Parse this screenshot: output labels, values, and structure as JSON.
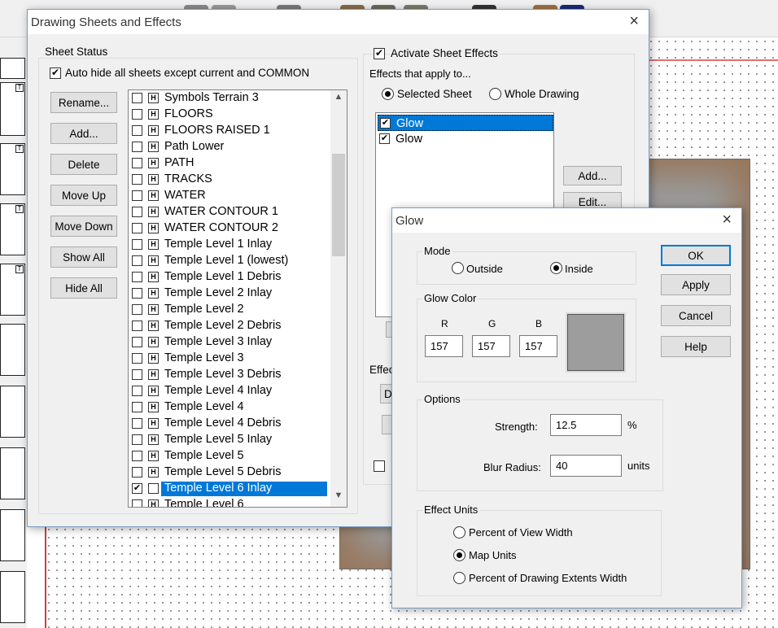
{
  "main_dialog": {
    "title": "Drawing Sheets and Effects",
    "close_glyph": "×",
    "sheet_status": {
      "label": "Sheet Status",
      "auto_hide_label": "Auto hide all sheets except current and COMMON",
      "auto_hide_checked": true,
      "buttons": [
        "Rename...",
        "Add...",
        "Delete",
        "Move Up",
        "Move Down",
        "Show All",
        "Hide All"
      ],
      "sheets": [
        {
          "name": "Symbols Terrain 3",
          "visible": false,
          "selected": false
        },
        {
          "name": "FLOORS",
          "visible": false,
          "selected": false
        },
        {
          "name": "FLOORS RAISED 1",
          "visible": false,
          "selected": false
        },
        {
          "name": "Path Lower",
          "visible": false,
          "selected": false
        },
        {
          "name": "PATH",
          "visible": false,
          "selected": false
        },
        {
          "name": "TRACKS",
          "visible": false,
          "selected": false
        },
        {
          "name": "WATER",
          "visible": false,
          "selected": false
        },
        {
          "name": "WATER CONTOUR 1",
          "visible": false,
          "selected": false
        },
        {
          "name": "WATER CONTOUR 2",
          "visible": false,
          "selected": false
        },
        {
          "name": "Temple Level 1 Inlay",
          "visible": false,
          "selected": false
        },
        {
          "name": "Temple Level 1 (lowest)",
          "visible": false,
          "selected": false
        },
        {
          "name": "Temple Level 1 Debris",
          "visible": false,
          "selected": false
        },
        {
          "name": "Temple Level 2 Inlay",
          "visible": false,
          "selected": false
        },
        {
          "name": "Temple Level 2",
          "visible": false,
          "selected": false
        },
        {
          "name": "Temple Level 2 Debris",
          "visible": false,
          "selected": false
        },
        {
          "name": "Temple Level 3 Inlay",
          "visible": false,
          "selected": false
        },
        {
          "name": "Temple Level 3",
          "visible": false,
          "selected": false
        },
        {
          "name": "Temple Level 3 Debris",
          "visible": false,
          "selected": false
        },
        {
          "name": "Temple Level 4 Inlay",
          "visible": false,
          "selected": false
        },
        {
          "name": "Temple Level 4",
          "visible": false,
          "selected": false
        },
        {
          "name": "Temple Level 4 Debris",
          "visible": false,
          "selected": false
        },
        {
          "name": "Temple Level 5 Inlay",
          "visible": false,
          "selected": false
        },
        {
          "name": "Temple Level 5",
          "visible": false,
          "selected": false
        },
        {
          "name": "Temple Level 5 Debris",
          "visible": false,
          "selected": false
        },
        {
          "name": "Temple Level 6 Inlay",
          "visible": true,
          "selected": true
        },
        {
          "name": "Temple Level 6",
          "visible": false,
          "selected": false
        }
      ]
    },
    "effects": {
      "activate_label": "Activate Sheet Effects",
      "activate_checked": true,
      "apply_to_label": "Effects that apply to...",
      "radio_selected_sheet": "Selected Sheet",
      "radio_whole_drawing": "Whole Drawing",
      "selected_scope": "Selected Sheet",
      "effect_items": [
        {
          "name": "Glow",
          "checked": true,
          "selected": true
        },
        {
          "name": "Glow",
          "checked": true,
          "selected": false
        }
      ],
      "add_button": "Add...",
      "edit_button": "Edit...",
      "partial_label": "Effec",
      "partial_button": "D"
    }
  },
  "glow_dialog": {
    "title": "Glow",
    "close_glyph": "×",
    "mode": {
      "label": "Mode",
      "outside": "Outside",
      "inside": "Inside",
      "selected": "Inside"
    },
    "glow_color": {
      "label": "Glow Color",
      "r_label": "R",
      "g_label": "G",
      "b_label": "B",
      "r": "157",
      "g": "157",
      "b": "157",
      "swatch_color": "#9d9d9d"
    },
    "options": {
      "label": "Options",
      "strength_label": "Strength:",
      "strength_value": "12.5",
      "strength_unit": "%",
      "blur_label": "Blur Radius:",
      "blur_value": "40",
      "blur_unit": "units"
    },
    "effect_units": {
      "label": "Effect Units",
      "opt1": "Percent of View Width",
      "opt2": "Map Units",
      "opt3": "Percent of Drawing Extents Width",
      "selected": "Map Units"
    },
    "buttons": {
      "ok": "OK",
      "apply": "Apply",
      "cancel": "Cancel",
      "help": "Help"
    }
  }
}
